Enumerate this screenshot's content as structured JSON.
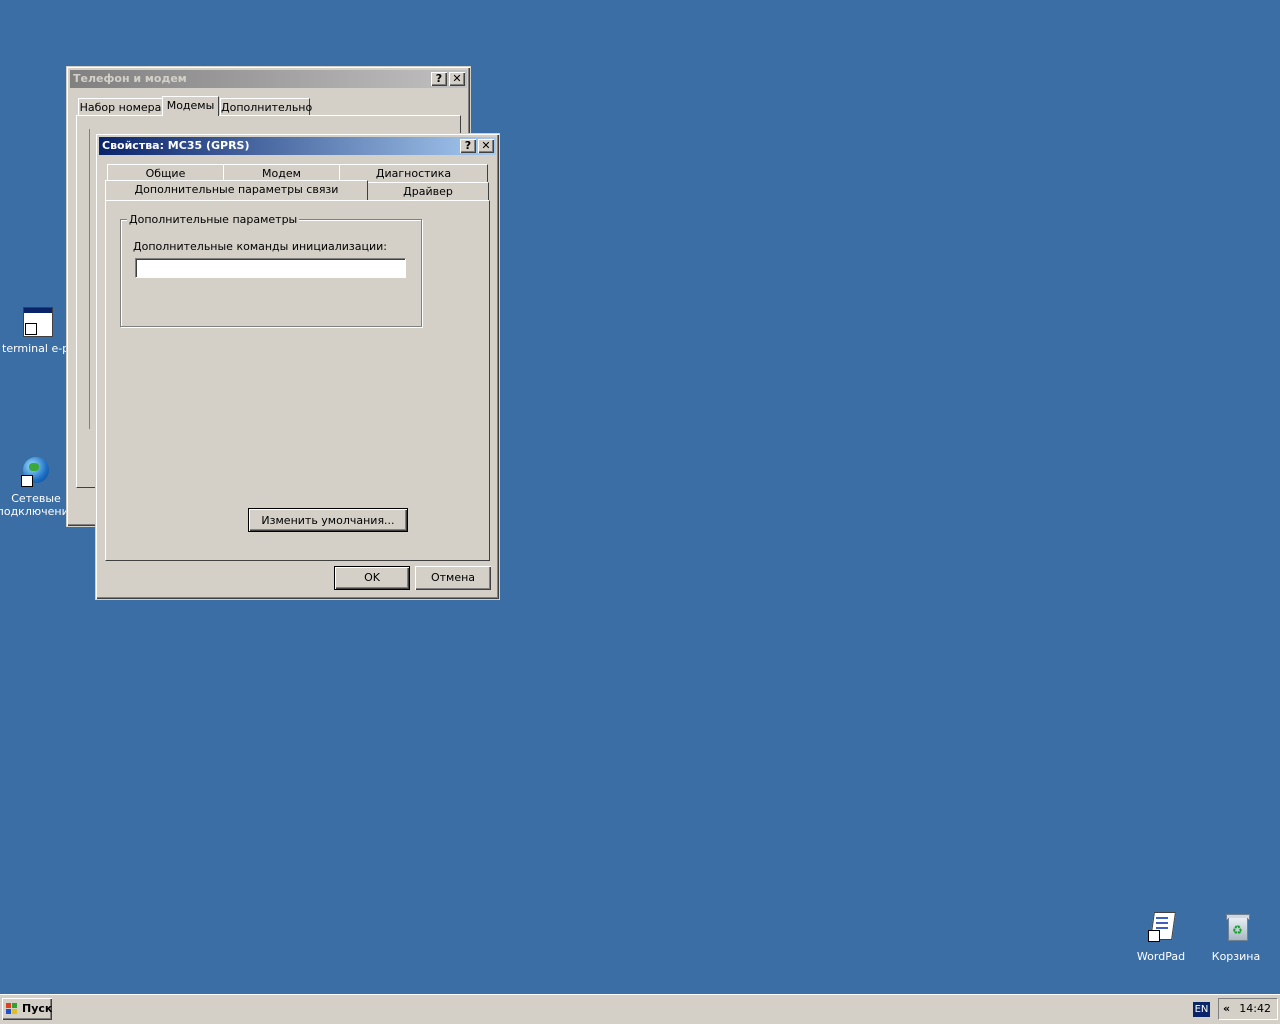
{
  "desktop": {
    "icons": [
      {
        "label": "terminal e-port"
      },
      {
        "label_line1": "Сетевые",
        "label_line2": "подключения"
      },
      {
        "label": "WordPad"
      },
      {
        "label": "Корзина"
      }
    ]
  },
  "back_window": {
    "title": "Телефон и модем",
    "help_btn": "?",
    "close_btn": "✕",
    "tabs": [
      "Набор номера",
      "Модемы",
      "Дополнительно"
    ],
    "active_tab": "Модемы"
  },
  "front_window": {
    "title": "Свойства: MC35 (GPRS)",
    "help_btn": "?",
    "close_btn": "✕",
    "tabs_row1": [
      "Общие",
      "Модем",
      "Диагностика"
    ],
    "tabs_row2": [
      "Дополнительные параметры связи",
      "Драйвер"
    ],
    "active_tab": "Дополнительные параметры связи",
    "group_title": "Дополнительные параметры",
    "init_label": "Дополнительные команды инициализации:",
    "init_value": "",
    "change_defaults_button": "Изменить умолчания...",
    "ok_button": "OK",
    "cancel_button": "Отмена"
  },
  "taskbar": {
    "start_label": "Пуск",
    "lang": "EN",
    "tray_arrow": "«",
    "clock": "14:42"
  },
  "colors": {
    "desktop": "#3b6ea5",
    "face": "#d4d0c8",
    "title_active": "#0a246a",
    "title_inactive": "#808080"
  }
}
